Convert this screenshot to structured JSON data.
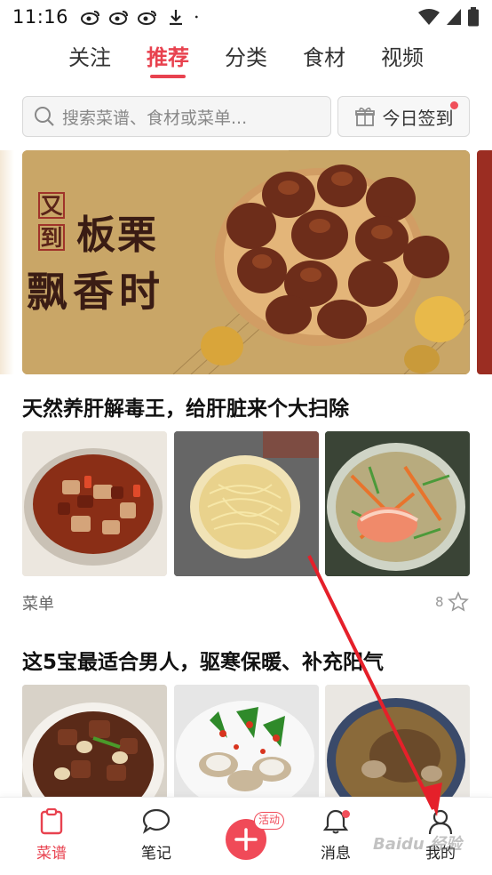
{
  "status_bar": {
    "time": "11:16"
  },
  "top_tabs": [
    {
      "label": "关注",
      "active": false
    },
    {
      "label": "推荐",
      "active": true
    },
    {
      "label": "分类",
      "active": false
    },
    {
      "label": "食材",
      "active": false
    },
    {
      "label": "视频",
      "active": false
    }
  ],
  "search": {
    "placeholder": "搜索菜谱、食材或菜单..."
  },
  "checkin": {
    "label": "今日签到"
  },
  "banner": {
    "line_small_1": "又",
    "line_small_2": "到",
    "line_big_1": "板栗",
    "line_big_2": "飘香时"
  },
  "feed": [
    {
      "title": "天然养肝解毒王，给肝脏来个大扫除",
      "type_label": "菜单",
      "fav_count": "8"
    },
    {
      "title": "这5宝最适合男人，驱寒保暖、补充阳气"
    }
  ],
  "bottom_nav": {
    "recipes": "菜谱",
    "notes": "笔记",
    "activity_tag": "活动",
    "messages": "消息",
    "mine": "我的"
  },
  "watermark": "Baidu 经验",
  "colors": {
    "accent": "#e8424f",
    "banner_bg": "#c8a566"
  }
}
